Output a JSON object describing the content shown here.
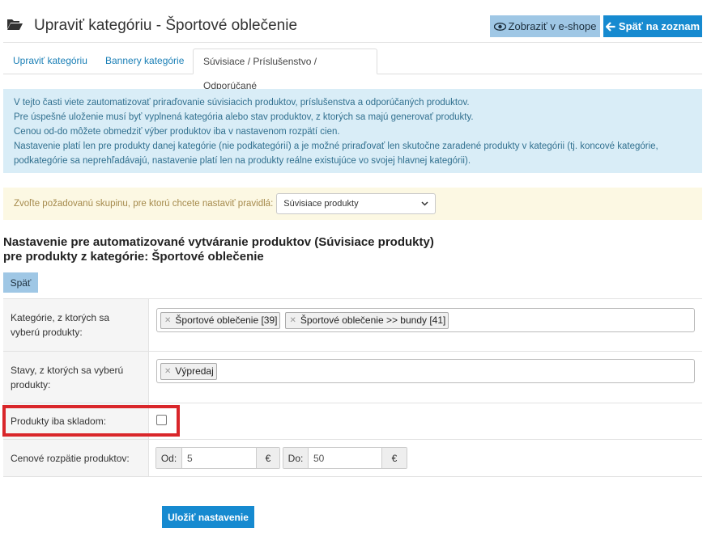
{
  "header": {
    "title": "Upraviť kategóriu - Športové oblečenie",
    "eshop_button": "Zobraziť v e-shope",
    "back_button": "Späť na zoznam"
  },
  "tabs": [
    {
      "label": "Upraviť kategóriu",
      "active": false
    },
    {
      "label": "Bannery kategórie",
      "active": false
    },
    {
      "label": "Súvisiace / Príslušenstvo / Odporúčané",
      "active": true
    }
  ],
  "info": {
    "lines": [
      "V tejto časti viete zautomatizovať priraďovanie súvisiacich produktov, príslušenstva a odporúčaných produktov.",
      "Pre úspešné uloženie musí byť vyplnená kategória alebo stav produktov, z ktorých sa majú generovať produkty.",
      "Cenou od-do môžete obmedziť výber produktov iba v nastavenom rozpätí cien.",
      "Nastavenie platí len pre produkty danej kategórie (nie podkategórií) a je možné priraďovať len skutočne zaradené produkty v kategórii (tj. koncové kategórie,",
      "podkategórie sa neprehľadávajú, nastavenie platí len na produkty reálne existujúce vo svojej hlavnej kategórii)."
    ]
  },
  "group_select": {
    "label": "Zvoľte požadovanú skupinu, pre ktorú chcete nastaviť pravidlá:",
    "value": "Súvisiace produkty"
  },
  "section": {
    "title_line1": "Nastavenie pre automatizované vytváranie produktov (Súvisiace produkty)",
    "title_line2": "pre produkty z kategórie: Športové oblečenie",
    "back_button": "Späť"
  },
  "form": {
    "categories": {
      "label": "Kategórie, z ktorých sa vyberú produkty:",
      "tags": [
        "Športové oblečenie [39]",
        "Športové oblečenie >> bundy [41]"
      ]
    },
    "states": {
      "label": "Stavy, z ktorých sa vyberú produkty:",
      "tags": [
        "Výpredaj"
      ]
    },
    "stock_only": {
      "label": "Produkty iba skladom:",
      "checked": false
    },
    "price_range": {
      "label": "Cenové rozpätie produktov:",
      "from_label": "Od:",
      "from_value": "5",
      "to_label": "Do:",
      "to_value": "50",
      "currency": "€"
    }
  },
  "save_button": "Uložiť nastavenie",
  "colors": {
    "primary": "#168ad0",
    "secondary": "#9fc7e5",
    "info_bg": "#d9edf7",
    "warning_bg": "#fcf8e3",
    "highlight": "#d9262a"
  },
  "icons": {
    "header": "folder-open-icon",
    "eshop": "eye-icon",
    "back": "arrow-left-icon",
    "select": "chevron-down-icon",
    "tag_remove": "close-icon"
  }
}
